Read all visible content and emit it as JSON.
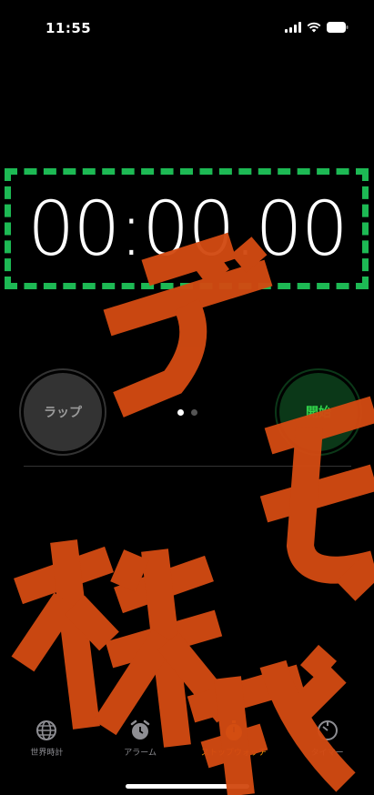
{
  "status_bar": {
    "time": "11:55"
  },
  "stopwatch": {
    "time_display": "00:00.00"
  },
  "controls": {
    "lap_label": "ラップ",
    "start_label": "開始",
    "page_count": 2,
    "active_page": 1
  },
  "tabs": [
    {
      "label": "世界時計",
      "icon": "globe-icon",
      "active": false
    },
    {
      "label": "アラーム",
      "icon": "alarm-clock-icon",
      "active": false
    },
    {
      "label": "ストップウォッチ",
      "icon": "stopwatch-icon",
      "active": true
    },
    {
      "label": "タイマー",
      "icon": "timer-icon",
      "active": false
    }
  ],
  "overlay_stamp": {
    "text": "デモ株式",
    "color": "#d24a12"
  },
  "colors": {
    "highlight_frame": "#1db954",
    "start_green": "#32d74b",
    "active_tab": "#ff9f0a"
  }
}
